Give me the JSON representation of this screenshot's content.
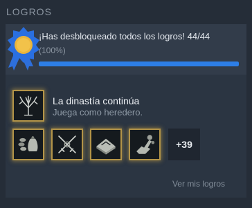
{
  "section": {
    "title": "LOGROS"
  },
  "summary": {
    "title": "¡Has desbloqueado todos los logros! 44/44",
    "percent_text": "(100%)",
    "progress": 1.0,
    "badge_icon": "ribbon-badge-icon"
  },
  "featured": {
    "title": "La dinastía continúa",
    "description": "Juega como heredero.",
    "icon": "tree-achievement-icon"
  },
  "recent": [
    {
      "icon": "coin-purse-achievement-icon"
    },
    {
      "icon": "crossed-swords-achievement-icon"
    },
    {
      "icon": "book-achievement-icon"
    },
    {
      "icon": "hand-achievement-icon"
    }
  ],
  "more": {
    "label": "+39"
  },
  "view_link": {
    "label": "Ver mis logros"
  },
  "colors": {
    "accent": "#2d7ee6",
    "gold_border": "#b39448",
    "background": "#252d38"
  }
}
